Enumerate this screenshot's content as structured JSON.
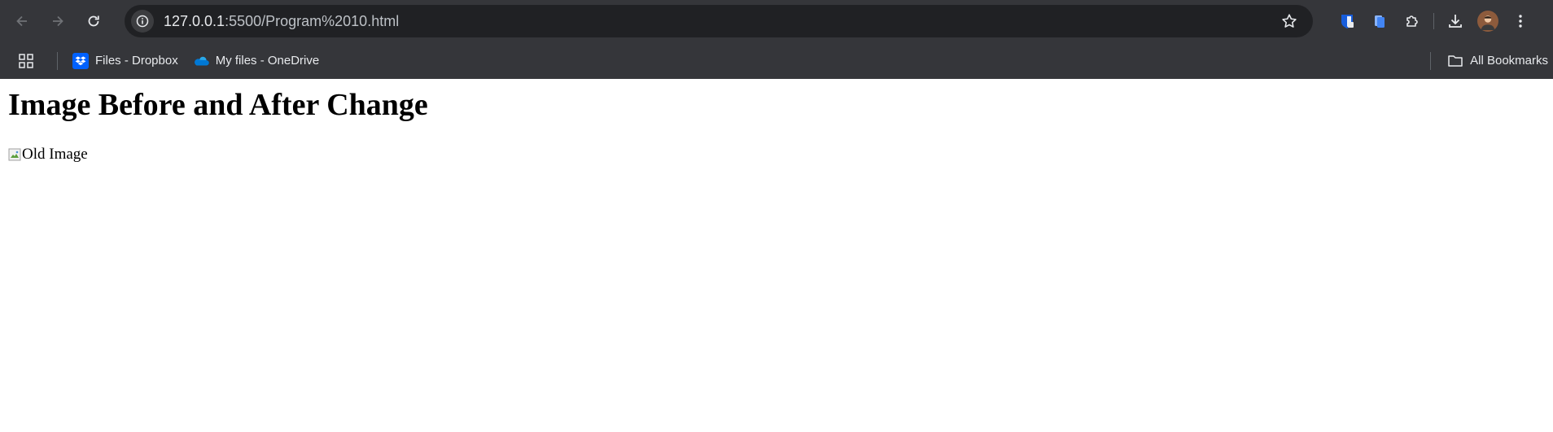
{
  "browser": {
    "url_host": "127.0.0.1",
    "url_rest": ":5500/Program%2010.html",
    "bookmarks": [
      {
        "label": "Files - Dropbox",
        "icon": "dropbox-icon"
      },
      {
        "label": "My files - OneDrive",
        "icon": "onedrive-icon"
      }
    ],
    "all_bookmarks_label": "All Bookmarks"
  },
  "page": {
    "heading": "Image Before and After Change",
    "image_alt": "Old Image"
  },
  "colors": {
    "toolbar_bg": "#35363a",
    "omnibox_bg": "#202124",
    "dropbox_blue": "#0061fe",
    "onedrive_blue": "#0078d4"
  }
}
